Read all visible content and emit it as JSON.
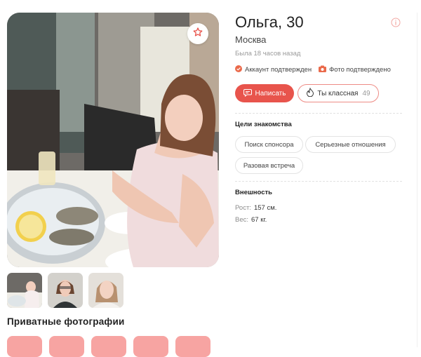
{
  "profile": {
    "name_age": "Ольга, 30",
    "city": "Москва",
    "last_seen": "Была 18 часов назад",
    "badges": {
      "account": "Аккаунт подтвержден",
      "photo": "Фото подтверждено"
    }
  },
  "actions": {
    "write_label": "Написать",
    "like_label": "Ты классная",
    "like_count": "49"
  },
  "goals": {
    "title": "Цели знакомства",
    "tags": [
      "Поиск спонсора",
      "Серьезные отношения",
      "Разовая встреча"
    ]
  },
  "appearance": {
    "title": "Внешность",
    "height_label": "Рост:",
    "height_value": "157 см.",
    "weight_label": "Вес:",
    "weight_value": "67 кг."
  },
  "gallery": {
    "private_title": "Приватные фотографии"
  },
  "colors": {
    "accent": "#e8544c",
    "private_tile": "#f7a4a2",
    "badge_icon": "#ea6a4b"
  },
  "icons": [
    "star-icon",
    "info-icon",
    "check-circle-icon",
    "camera-icon",
    "chat-icon",
    "flame-icon"
  ]
}
